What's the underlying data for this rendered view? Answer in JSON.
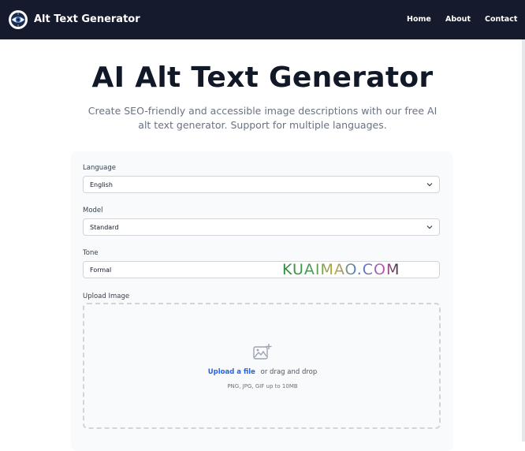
{
  "nav": {
    "brand": "Alt Text Generator",
    "logo_icon": "eye-logo-icon",
    "links": [
      "Home",
      "About",
      "Contact"
    ]
  },
  "hero": {
    "title": "AI Alt Text Generator",
    "subtitle": "Create SEO-friendly and accessible image descriptions with our free AI alt text generator. Support for multiple languages."
  },
  "form": {
    "language": {
      "label": "Language",
      "value": "English"
    },
    "model": {
      "label": "Model",
      "value": "Standard"
    },
    "tone": {
      "label": "Tone",
      "value": "Formal"
    },
    "upload": {
      "label": "Upload Image",
      "link": "Upload a file",
      "or_text": "or drag and drop",
      "hint": "PNG, JPG, GIF up to 10MB",
      "icon": "image-upload-icon"
    }
  },
  "watermark": {
    "text": "KUAIMAO.COM"
  },
  "colors": {
    "nav_bg": "#151b2d",
    "accent": "#2563eb",
    "card_bg": "#f9fafb"
  }
}
